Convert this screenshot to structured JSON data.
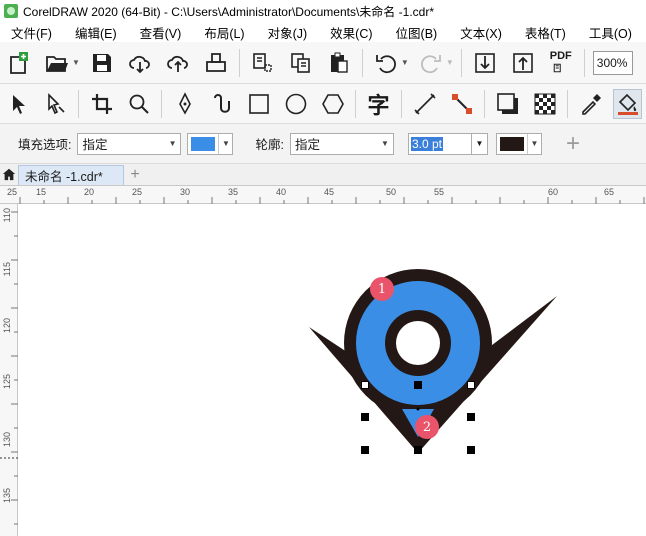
{
  "window": {
    "title": "CorelDRAW 2020 (64-Bit) - C:\\Users\\Administrator\\Documents\\未命名 -1.cdr*"
  },
  "menu": [
    {
      "label": "文件(F)"
    },
    {
      "label": "编辑(E)"
    },
    {
      "label": "查看(V)"
    },
    {
      "label": "布局(L)"
    },
    {
      "label": "对象(J)"
    },
    {
      "label": "效果(C)"
    },
    {
      "label": "位图(B)"
    },
    {
      "label": "文本(X)"
    },
    {
      "label": "表格(T)"
    },
    {
      "label": "工具(O)"
    }
  ],
  "toolbar": {
    "pdf_label": "PDF",
    "zoom": "300%"
  },
  "props": {
    "fill_label": "填充选项:",
    "fill_value": "指定",
    "fill_color": "#3b8ee6",
    "outline_label": "轮廓:",
    "outline_value": "指定",
    "outline_width": "3.0 pt",
    "outline_color": "#231815"
  },
  "tabs": {
    "doc": "未命名 -1.cdr*"
  },
  "ruler": {
    "h": [
      "25",
      "15",
      "20",
      "25",
      "30",
      "35",
      "40",
      "45",
      "50",
      "55",
      "60",
      "65"
    ],
    "v": [
      "110",
      "115",
      "120",
      "125",
      "130",
      "135"
    ]
  },
  "canvas": {
    "badge1": "1",
    "badge2": "2",
    "shape_fill": "#3b8ee6",
    "shape_outline": "#231815"
  }
}
